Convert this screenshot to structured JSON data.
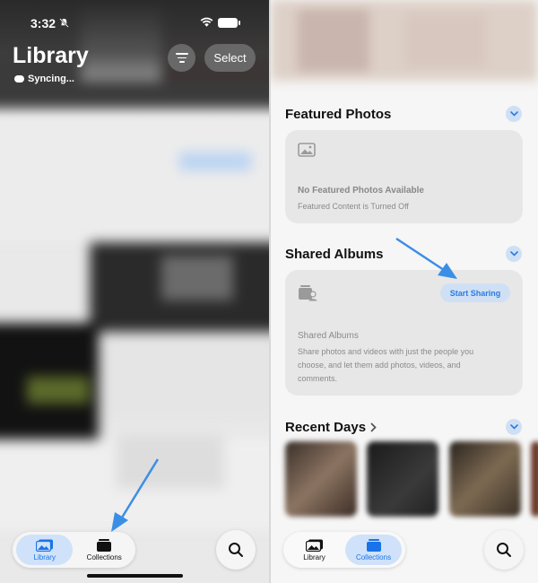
{
  "left_screen": {
    "status_time": "3:32",
    "title": "Library",
    "sync_status": "Syncing...",
    "select_label": "Select",
    "tabs": [
      {
        "label": "Library",
        "icon": "photos-icon",
        "active": true
      },
      {
        "label": "Collections",
        "icon": "collections-icon",
        "active": false
      }
    ],
    "search_icon": "search-icon"
  },
  "right_screen": {
    "featured": {
      "title": "Featured Photos",
      "empty_title": "No Featured Photos Available",
      "empty_sub": "Featured Content is Turned Off"
    },
    "shared": {
      "title": "Shared Albums",
      "button": "Start Sharing",
      "card_title": "Shared Albums",
      "card_lines": [
        "Share photos and videos with just the people you",
        "choose, and let them add photos, videos, and",
        "comments."
      ]
    },
    "recent": {
      "title": "Recent Days"
    },
    "tabs": [
      {
        "label": "Library",
        "icon": "photos-icon",
        "active": false
      },
      {
        "label": "Collections",
        "icon": "collections-icon",
        "active": true
      }
    ],
    "search_icon": "search-icon"
  },
  "colors": {
    "accent": "#2d7be0",
    "arrow": "#3b8ee6",
    "active_tab_bg": "#cfe2f9"
  }
}
